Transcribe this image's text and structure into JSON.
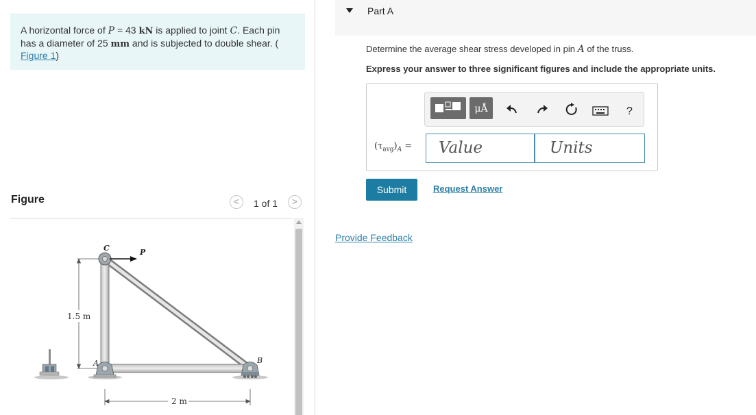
{
  "problem": {
    "line1_pre": "A horizontal force of ",
    "p_sym": "P",
    "p_val": " = 43 ",
    "p_unit": "kN",
    "line1_post": " is applied to joint ",
    "joint": "C",
    "line1_end": ". Each pin",
    "line2": "has a diameter of 25 ",
    "diam_unit": "mm",
    "line2_post": " and is subjected to double shear. (",
    "figure_link": "Figure 1",
    "close": ")"
  },
  "figure": {
    "heading": "Figure",
    "pager": "1 of 1",
    "prev_icon": "<",
    "next_icon": ">",
    "labels": {
      "c": "C",
      "p": "P",
      "a": "A",
      "b": "B",
      "height": "1.5 m",
      "width": "2 m"
    }
  },
  "part": {
    "title": "Part A",
    "question_pre": "Determine the average shear stress developed in pin ",
    "question_var": "A",
    "question_post": " of the truss.",
    "instruction": "Express your answer to three significant figures and include the appropriate units.",
    "toolbar": {
      "units_label": "μÅ",
      "icons": [
        "templates-icon",
        "units-icon",
        "undo-icon",
        "redo-icon",
        "reset-icon",
        "keyboard-icon",
        "help-icon"
      ],
      "help_label": "?"
    },
    "answer_label_base": "(τ",
    "answer_label_sub": "avg",
    "answer_label_tail": ")",
    "answer_label_var": "A",
    "answer_label_eq": " =",
    "value_placeholder": "Value",
    "units_placeholder": "Units",
    "submit": "Submit",
    "request_answer": "Request Answer"
  },
  "feedback": "Provide Feedback",
  "colors": {
    "accent": "#1c7ca1",
    "link": "#2e7fa7",
    "problem_bg": "#e8f6f8"
  }
}
